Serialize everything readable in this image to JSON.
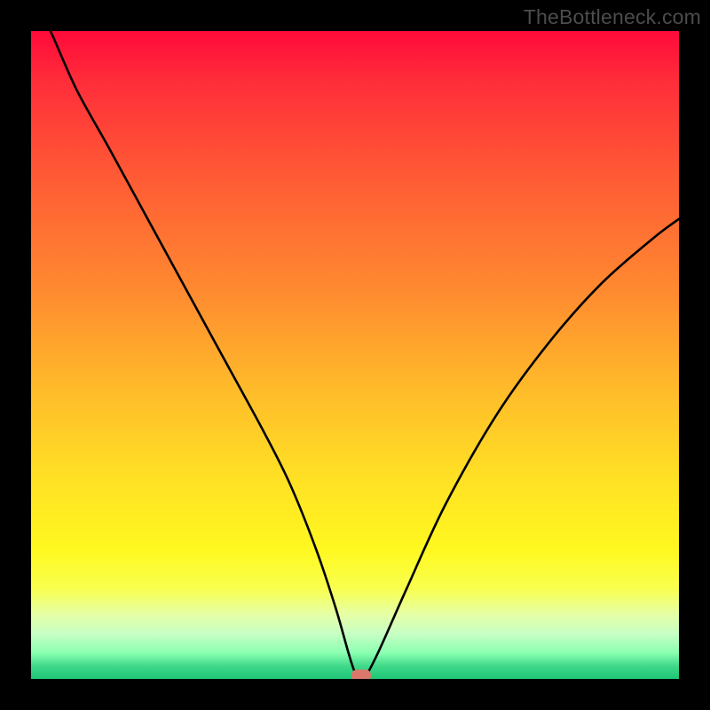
{
  "watermark": "TheBottleneck.com",
  "colors": {
    "page_bg": "#000000",
    "watermark": "#4c4c4c",
    "curve": "#000000",
    "marker": "#d9786b",
    "gradient_top": "#ff0a3a",
    "gradient_bottom": "#1ec576"
  },
  "chart_data": {
    "type": "line",
    "title": "",
    "xlabel": "",
    "ylabel": "",
    "xlim": [
      0,
      100
    ],
    "ylim": [
      0,
      100
    ],
    "grid": false,
    "legend": false,
    "series": [
      {
        "name": "bottleneck-curve",
        "x": [
          0,
          3,
          7,
          12,
          18,
          24,
          30,
          36,
          40,
          44,
          47,
          49,
          50,
          51,
          52,
          54,
          58,
          64,
          72,
          80,
          88,
          96,
          100
        ],
        "values": [
          106,
          100,
          91,
          82,
          71,
          60,
          49,
          38,
          30,
          20,
          11,
          4,
          1,
          0,
          1,
          5,
          14,
          27,
          41,
          52,
          61,
          68,
          71
        ]
      }
    ],
    "marker": {
      "x": 51,
      "y": 0
    },
    "background": "vertical-gradient-red-to-green"
  }
}
